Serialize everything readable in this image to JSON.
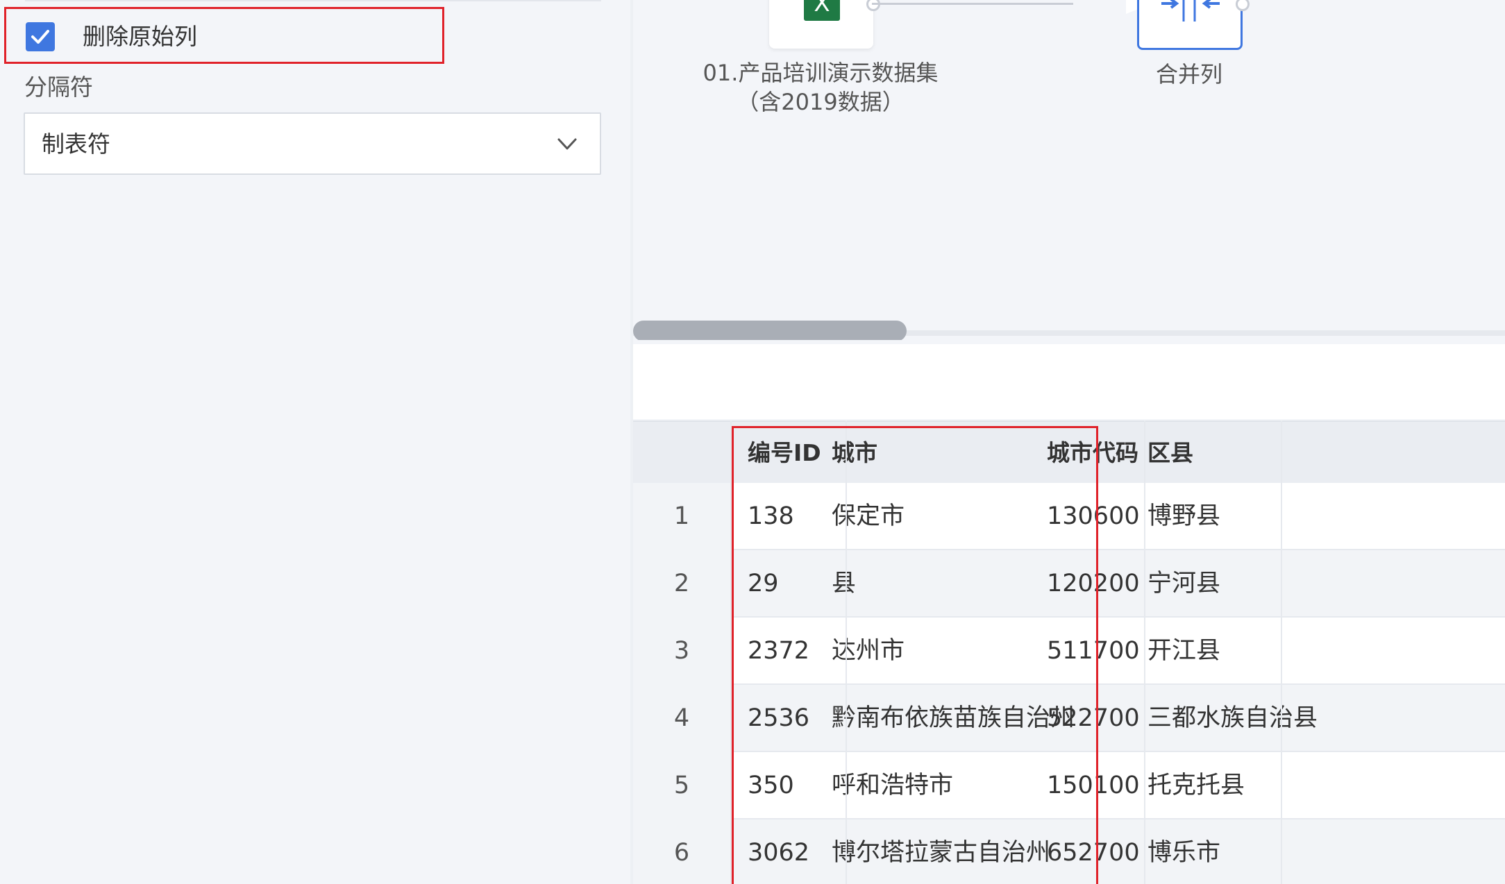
{
  "settings": {
    "delete_original_label": "删除原始列",
    "delete_original_checked": true,
    "separator_label": "分隔符",
    "separator_value": "制表符"
  },
  "canvas": {
    "source_node_label": "01.产品培训演示数据集（含2019数据）",
    "merge_node_label": "合并列",
    "source_icon": "excel-icon",
    "merge_icon": "merge-columns-icon"
  },
  "table": {
    "columns": [
      "编号ID",
      "城市",
      "城市代码",
      "区县"
    ],
    "rows": [
      {
        "num": "1",
        "cells": [
          "138",
          "保定市",
          "130600",
          "博野县"
        ]
      },
      {
        "num": "2",
        "cells": [
          "29",
          "县",
          "120200",
          "宁河县"
        ]
      },
      {
        "num": "3",
        "cells": [
          "2372",
          "达州市",
          "511700",
          "开江县"
        ]
      },
      {
        "num": "4",
        "cells": [
          "2536",
          "黔南布依族苗族自治州",
          "522700",
          "三都水族自治县"
        ]
      },
      {
        "num": "5",
        "cells": [
          "350",
          "呼和浩特市",
          "150100",
          "托克托县"
        ]
      },
      {
        "num": "6",
        "cells": [
          "3062",
          "博尔塔拉蒙古自治州",
          "652700",
          "博乐市"
        ]
      }
    ]
  },
  "colors": {
    "accent": "#3f77e0",
    "highlight": "#e0222a",
    "excel": "#1f7a44"
  }
}
